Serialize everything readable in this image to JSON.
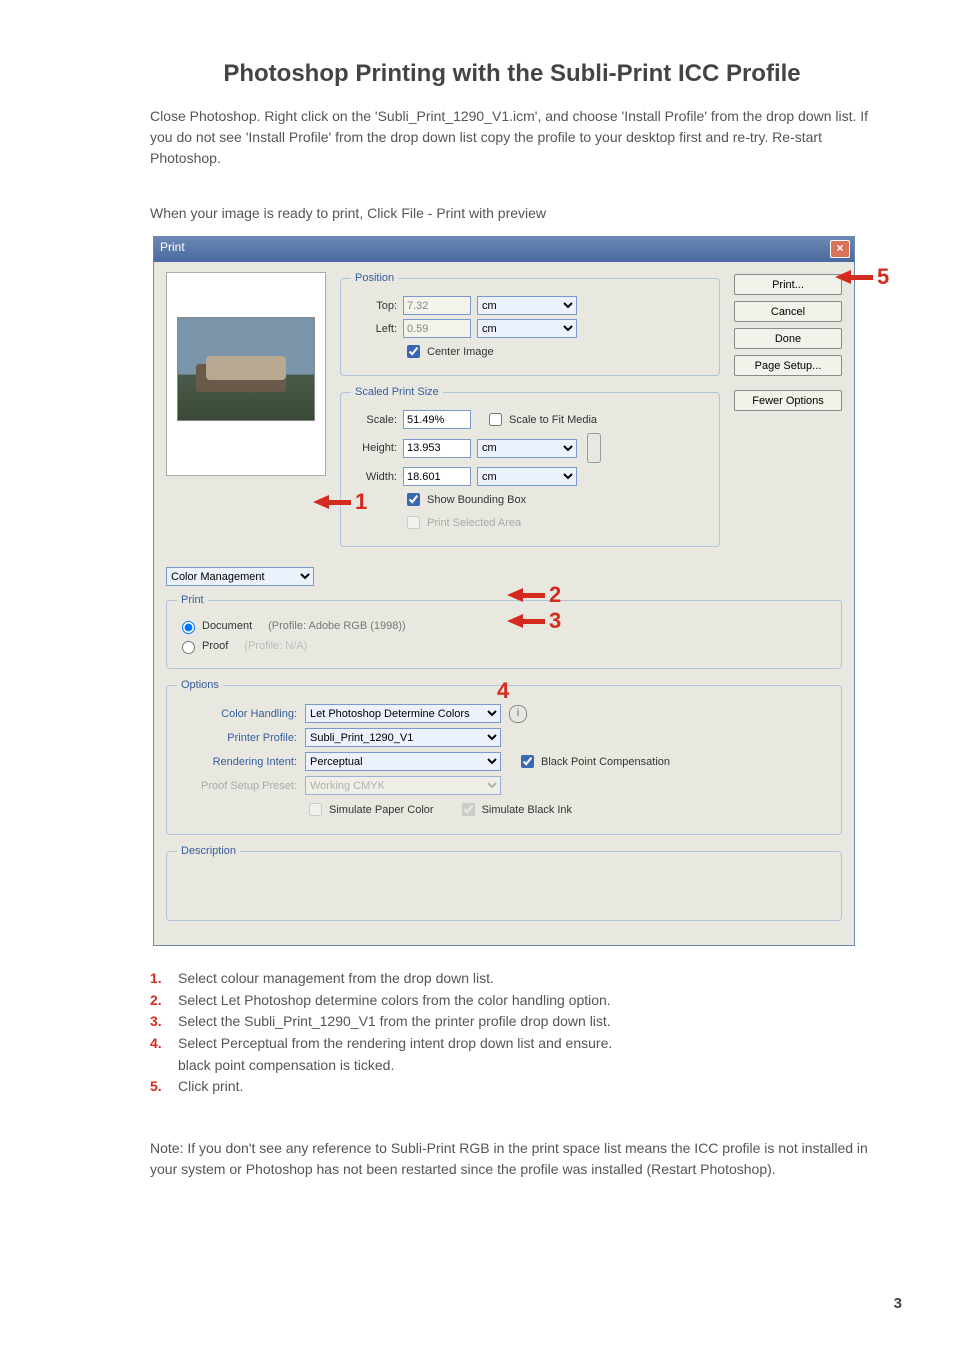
{
  "title": "Photoshop Printing with the Subli-Print ICC Profile",
  "intro": "Close Photoshop. Right click on the 'Subli_Print_1290_V1.icm', and choose 'Install Profile' from the drop down list. If you do not see 'Install Profile' from the drop down list copy the profile to your desktop first and re-try. Re-start Photoshop.",
  "prelude": "When your image is ready to print, Click File - Print with preview",
  "dialog": {
    "title": "Print",
    "position": {
      "legend": "Position",
      "top_label": "Top:",
      "top_value": "7.32",
      "left_label": "Left:",
      "left_value": "0.59",
      "unit": "cm",
      "center_image_label": "Center Image",
      "center_image_checked": true
    },
    "scaled": {
      "legend": "Scaled Print Size",
      "scale_label": "Scale:",
      "scale_value": "51.49%",
      "scale_fit_label": "Scale to Fit Media",
      "scale_fit_checked": false,
      "height_label": "Height:",
      "height_value": "13.953",
      "width_label": "Width:",
      "width_value": "18.601",
      "unit": "cm",
      "show_bbox_label": "Show Bounding Box",
      "show_bbox_checked": true,
      "print_sel_label": "Print Selected Area",
      "print_sel_checked": false
    },
    "buttons": {
      "print": "Print...",
      "cancel": "Cancel",
      "done": "Done",
      "page_setup": "Page Setup...",
      "fewer": "Fewer Options"
    },
    "section_select": "Color Management",
    "print_group": {
      "legend": "Print",
      "document_label": "Document",
      "document_profile": "(Profile: Adobe RGB (1998))",
      "proof_label": "Proof",
      "proof_profile": "(Profile: N/A)"
    },
    "options": {
      "legend": "Options",
      "color_handling_label": "Color Handling:",
      "color_handling_value": "Let Photoshop Determine Colors",
      "printer_profile_label": "Printer Profile:",
      "printer_profile_value": "Subli_Print_1290_V1",
      "rendering_intent_label": "Rendering Intent:",
      "rendering_intent_value": "Perceptual",
      "bpc_label": "Black Point Compensation",
      "bpc_checked": true,
      "proof_preset_label": "Proof Setup Preset:",
      "proof_preset_value": "Working CMYK",
      "sim_paper_label": "Simulate Paper Color",
      "sim_paper_checked": false,
      "sim_black_label": "Simulate Black Ink",
      "sim_black_checked": true
    },
    "description_legend": "Description"
  },
  "annos": {
    "n1": "1",
    "n2": "2",
    "n3": "3",
    "n4": "4",
    "n5": "5"
  },
  "steps": {
    "s1n": "1.",
    "s1": "Select colour management from the drop down list.",
    "s2n": "2.",
    "s2": "Select Let Photoshop determine colors from the color handling option.",
    "s3n": "3.",
    "s3": "Select the Subli_Print_1290_V1 from the printer profile drop down list.",
    "s4n": "4.",
    "s4": "Select Perceptual from the rendering intent drop down list and ensure.",
    "s4b": "black point compensation is ticked.",
    "s5n": "5.",
    "s5": "Click print."
  },
  "note": "Note: If you don't see any reference to Subli-Print RGB in the print space list means the ICC profile is not installed in your system or Photoshop has not been restarted since the profile was installed (Restart Photoshop).",
  "pagenum": "3"
}
